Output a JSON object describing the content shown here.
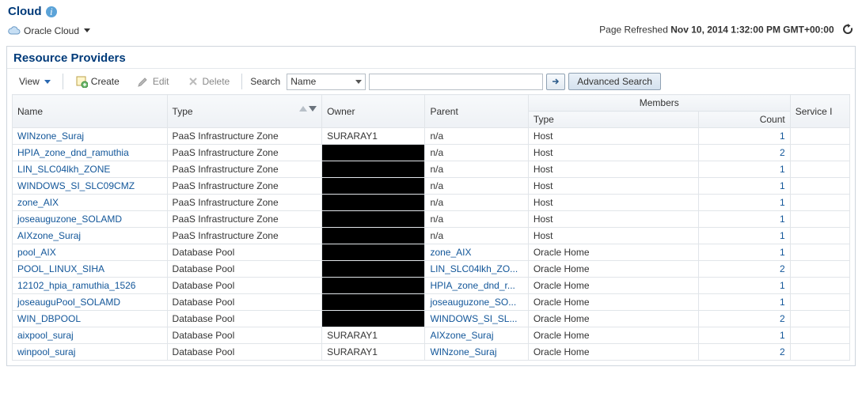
{
  "header": {
    "title": "Cloud",
    "breadcrumb": "Oracle Cloud",
    "refresh_label": "Page Refreshed",
    "refresh_time": "Nov 10, 2014 1:32:00 PM GMT+00:00"
  },
  "panel": {
    "title": "Resource Providers"
  },
  "toolbar": {
    "view": "View",
    "create": "Create",
    "edit": "Edit",
    "delete": "Delete",
    "search_label": "Search",
    "search_field_selected": "Name",
    "search_value": "",
    "advanced": "Advanced Search"
  },
  "columns": {
    "name": "Name",
    "type": "Type",
    "owner": "Owner",
    "parent": "Parent",
    "members": "Members",
    "member_type": "Type",
    "count": "Count",
    "service": "Service I"
  },
  "rows": [
    {
      "name": "WINzone_Suraj",
      "name_is_link": true,
      "type": "PaaS Infrastructure Zone",
      "owner": "SURARAY1",
      "owner_redacted": false,
      "parent": "n/a",
      "parent_is_link": false,
      "member_type": "Host",
      "count": "1"
    },
    {
      "name": "HPIA_zone_dnd_ramuthia",
      "name_is_link": true,
      "type": "PaaS Infrastructure Zone",
      "owner": "",
      "owner_redacted": true,
      "parent": "n/a",
      "parent_is_link": false,
      "member_type": "Host",
      "count": "2"
    },
    {
      "name": "LIN_SLC04lkh_ZONE",
      "name_is_link": true,
      "type": "PaaS Infrastructure Zone",
      "owner": "",
      "owner_redacted": true,
      "parent": "n/a",
      "parent_is_link": false,
      "member_type": "Host",
      "count": "1"
    },
    {
      "name": "WINDOWS_SI_SLC09CMZ",
      "name_is_link": true,
      "type": "PaaS Infrastructure Zone",
      "owner": "",
      "owner_redacted": true,
      "parent": "n/a",
      "parent_is_link": false,
      "member_type": "Host",
      "count": "1"
    },
    {
      "name": "zone_AIX",
      "name_is_link": true,
      "type": "PaaS Infrastructure Zone",
      "owner": "",
      "owner_redacted": true,
      "parent": "n/a",
      "parent_is_link": false,
      "member_type": "Host",
      "count": "1"
    },
    {
      "name": "joseauguzone_SOLAMD",
      "name_is_link": true,
      "type": "PaaS Infrastructure Zone",
      "owner": "",
      "owner_redacted": true,
      "parent": "n/a",
      "parent_is_link": false,
      "member_type": "Host",
      "count": "1"
    },
    {
      "name": "AIXzone_Suraj",
      "name_is_link": true,
      "type": "PaaS Infrastructure Zone",
      "owner": "",
      "owner_redacted": true,
      "parent": "n/a",
      "parent_is_link": false,
      "member_type": "Host",
      "count": "1"
    },
    {
      "name": "pool_AIX",
      "name_is_link": true,
      "type": "Database Pool",
      "owner": "",
      "owner_redacted": true,
      "parent": "zone_AIX",
      "parent_is_link": true,
      "member_type": "Oracle Home",
      "count": "1"
    },
    {
      "name": "POOL_LINUX_SIHA",
      "name_is_link": true,
      "type": "Database Pool",
      "owner": "",
      "owner_redacted": true,
      "parent": "LIN_SLC04lkh_ZO...",
      "parent_is_link": true,
      "member_type": "Oracle Home",
      "count": "2"
    },
    {
      "name": "12102_hpia_ramuthia_1526",
      "name_is_link": true,
      "type": "Database Pool",
      "owner": "",
      "owner_redacted": true,
      "parent": "HPIA_zone_dnd_r...",
      "parent_is_link": true,
      "member_type": "Oracle Home",
      "count": "1"
    },
    {
      "name": "joseauguPool_SOLAMD",
      "name_is_link": true,
      "type": "Database Pool",
      "owner": "",
      "owner_redacted": true,
      "parent": "joseauguzone_SO...",
      "parent_is_link": true,
      "member_type": "Oracle Home",
      "count": "1"
    },
    {
      "name": "WIN_DBPOOL",
      "name_is_link": true,
      "type": "Database Pool",
      "owner": "",
      "owner_redacted": true,
      "parent": "WINDOWS_SI_SL...",
      "parent_is_link": true,
      "member_type": "Oracle Home",
      "count": "2"
    },
    {
      "name": "aixpool_suraj",
      "name_is_link": true,
      "type": "Database Pool",
      "owner": "SURARAY1",
      "owner_redacted": false,
      "parent": "AIXzone_Suraj",
      "parent_is_link": true,
      "member_type": "Oracle Home",
      "count": "1"
    },
    {
      "name": "winpool_suraj",
      "name_is_link": true,
      "type": "Database Pool",
      "owner": "SURARAY1",
      "owner_redacted": false,
      "parent": "WINzone_Suraj",
      "parent_is_link": true,
      "member_type": "Oracle Home",
      "count": "2"
    }
  ]
}
